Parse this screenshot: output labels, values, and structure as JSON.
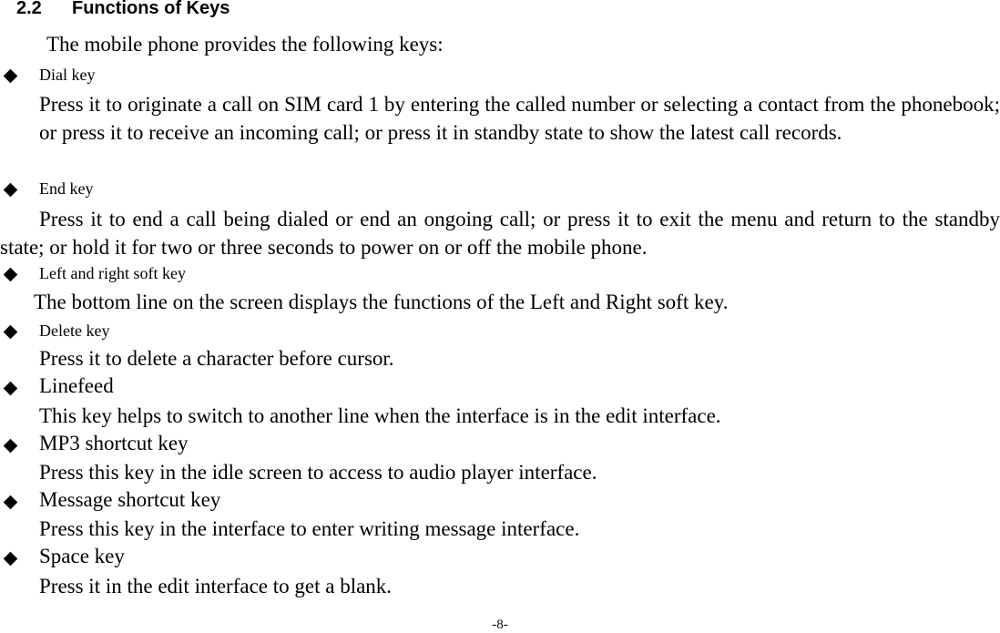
{
  "section": {
    "number": "2.2",
    "title": "Functions of Keys",
    "intro": "The mobile phone provides the following keys:"
  },
  "keys": [
    {
      "name": "Dial key",
      "description": "Press it to originate a call on SIM card 1 by entering the called number or selecting a contact from the phonebook; or press it to receive an incoming call; or press it in standby state to show the latest call records."
    },
    {
      "name": "End key",
      "description": "Press it to end a call being dialed or end an ongoing call; or press it to exit the menu and return to the standby state; or hold it for two or three seconds to power on or off the mobile phone."
    },
    {
      "name": "Left and right soft key",
      "description": "The bottom line on the screen displays the functions of the Left and Right soft key."
    },
    {
      "name": "Delete key",
      "description": "Press it to delete a character before cursor."
    },
    {
      "name": "Linefeed",
      "description": "This key helps to switch to another line when the interface is in the edit interface."
    },
    {
      "name": "MP3 shortcut key",
      "description": "Press this key in the idle screen to access to audio player interface."
    },
    {
      "name": "Message shortcut key",
      "description": "Press this key in the interface to enter writing message interface."
    },
    {
      "name": "Space key",
      "description": "Press it in the edit interface to get a blank."
    }
  ],
  "footer": {
    "page_number": "-8-"
  }
}
